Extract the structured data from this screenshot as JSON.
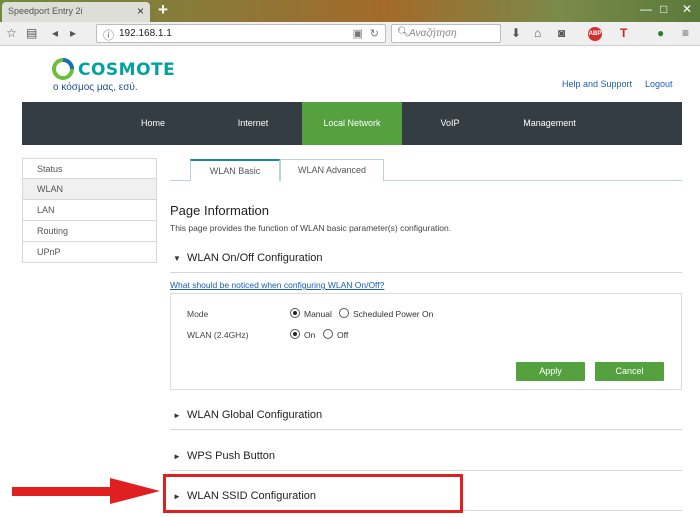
{
  "browser": {
    "tab_title": "Speedport Entry 2i",
    "tab_close": "×",
    "new_tab": "+",
    "url": "192.168.1.1",
    "search_placeholder": "Αναζήτηση",
    "icons": [
      "star-icon",
      "reader-icon",
      "back-icon",
      "info-icon",
      "lock-icon",
      "reload-icon",
      "search-icon",
      "download-icon",
      "home-icon",
      "pocket-icon",
      "adblock-icon",
      "addon-icon",
      "menu-icon"
    ],
    "adblock_badge": "ABP"
  },
  "header": {
    "logo_text": "COSMOTE",
    "tagline": "ο κόσμος μας, εσύ.",
    "help_link": "Help and Support",
    "logout_link": "Logout"
  },
  "main_nav": {
    "items": [
      {
        "label": "Home",
        "active": false
      },
      {
        "label": "Internet",
        "active": false
      },
      {
        "label": "Local Network",
        "active": true
      },
      {
        "label": "VoIP",
        "active": false
      },
      {
        "label": "Management",
        "active": false
      }
    ],
    "active_color": "#55a13f",
    "bg_color": "#343c44"
  },
  "sidebar": {
    "items": [
      {
        "label": "Status"
      },
      {
        "label": "WLAN"
      },
      {
        "label": "LAN"
      },
      {
        "label": "Routing"
      },
      {
        "label": "UPnP"
      }
    ]
  },
  "content_tabs": [
    {
      "label": "WLAN Basic"
    },
    {
      "label": "WLAN Advanced"
    }
  ],
  "page_info": {
    "title": "Page Information",
    "description": "This page provides the function of WLAN basic parameter(s) configuration."
  },
  "sections": {
    "onoff": {
      "title": "WLAN On/Off Configuration",
      "arrow": "▼"
    },
    "global": {
      "title": "WLAN Global Configuration",
      "arrow": "►"
    },
    "wps": {
      "title": "WPS Push Button",
      "arrow": "►"
    },
    "ssid": {
      "title": "WLAN SSID Configuration",
      "arrow": "►"
    }
  },
  "onoff_panel": {
    "help_link": "What should be noticed when configuring WLAN On/Off?",
    "mode_label": "Mode",
    "mode_options": [
      "Manual",
      "Scheduled Power On"
    ],
    "mode_selected": "Manual",
    "wlan_label": "WLAN (2.4GHz)",
    "wlan_options": [
      "On",
      "Off"
    ],
    "wlan_selected": "On",
    "apply_label": "Apply",
    "cancel_label": "Cancel"
  },
  "annotation_color": "#e02020"
}
